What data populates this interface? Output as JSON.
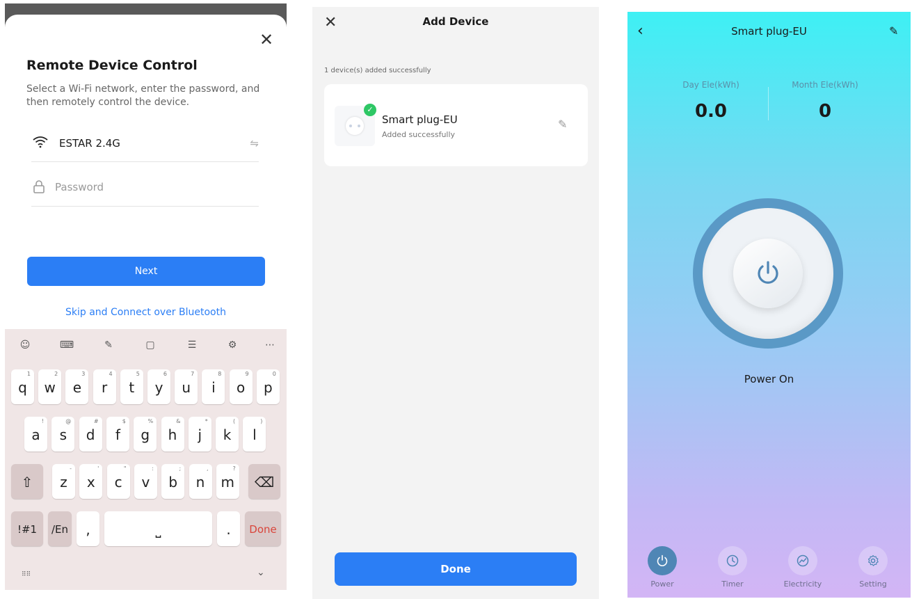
{
  "panel1": {
    "close_icon": "close-icon",
    "title": "Remote Device Control",
    "description": "Select a Wi-Fi network, enter the password, and then remotely control the device.",
    "wifi_name": "ESTAR 2.4G",
    "password_placeholder": "Password",
    "password_value": "",
    "next_label": "Next",
    "bluetooth_link": "Skip and Connect over Bluetooth",
    "keyboard": {
      "row1": [
        [
          "q",
          "1"
        ],
        [
          "w",
          "2"
        ],
        [
          "e",
          "3"
        ],
        [
          "r",
          "4"
        ],
        [
          "t",
          "5"
        ],
        [
          "y",
          "6"
        ],
        [
          "u",
          "7"
        ],
        [
          "i",
          "8"
        ],
        [
          "o",
          "9"
        ],
        [
          "p",
          "0"
        ]
      ],
      "row2": [
        [
          "a",
          "!"
        ],
        [
          "s",
          "@"
        ],
        [
          "d",
          "#"
        ],
        [
          "f",
          "$"
        ],
        [
          "g",
          "%"
        ],
        [
          "h",
          "&"
        ],
        [
          "j",
          "*"
        ],
        [
          "k",
          "("
        ],
        [
          "l",
          ")"
        ]
      ],
      "row3": [
        [
          "z",
          "-"
        ],
        [
          "x",
          "'"
        ],
        [
          "c",
          "\""
        ],
        [
          "v",
          ":"
        ],
        [
          "b",
          ";"
        ],
        [
          "n",
          ","
        ],
        [
          "m",
          "?"
        ]
      ],
      "symbols_key": "!#1",
      "lang_key": "/En",
      "comma_key": ",",
      "period_key": ".",
      "done_key": "Done",
      "accent_color": "#d9453b"
    }
  },
  "panel2": {
    "title": "Add Device",
    "added_count": "1 device(s) added successfully",
    "device_name": "Smart plug-EU",
    "device_status": "Added successfully",
    "done_label": "Done",
    "success_color": "#2ec765"
  },
  "panel3": {
    "title": "Smart plug-EU",
    "day_label": "Day Ele(kWh)",
    "day_value": "0.0",
    "month_label": "Month Ele(kWh)",
    "month_value": "0",
    "state_text": "Power On",
    "tabs": [
      {
        "label": "Power",
        "icon": "power-icon"
      },
      {
        "label": "Timer",
        "icon": "clock-icon"
      },
      {
        "label": "Electricity",
        "icon": "chart-icon"
      },
      {
        "label": "Setting",
        "icon": "gear-icon"
      }
    ],
    "ring_color": "#5a99c6",
    "accent_color": "#4f86b5"
  },
  "primary_blue": "#2b7ef5"
}
